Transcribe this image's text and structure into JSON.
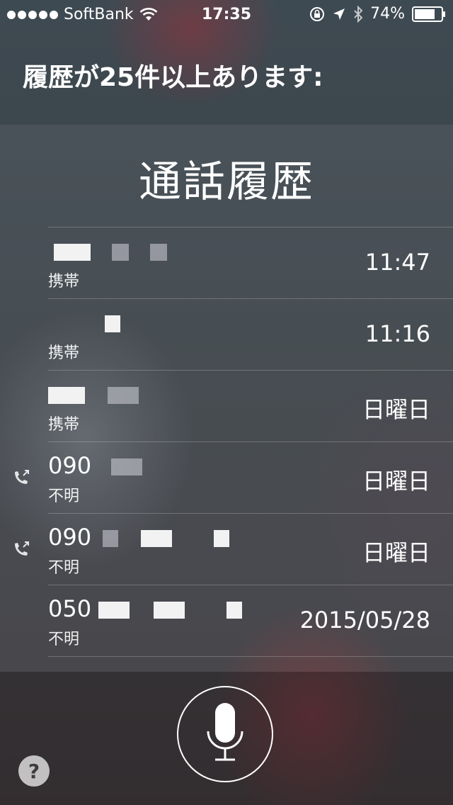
{
  "status_bar": {
    "carrier": "SoftBank",
    "time": "17:35",
    "battery": "74%",
    "icons": [
      "signal-dots-icon",
      "wifi-icon",
      "rotation-lock-icon",
      "location-arrow-icon",
      "bluetooth-icon",
      "battery-icon"
    ]
  },
  "siri": {
    "heading": "履歴が25件以上あります:"
  },
  "card": {
    "title": "通話履歴",
    "rows": [
      {
        "name": "",
        "type": "携帯",
        "when": "11:47",
        "outgoing": false
      },
      {
        "name": "",
        "type": "携帯",
        "when": "11:16",
        "outgoing": false
      },
      {
        "name": "",
        "type": "携帯",
        "when": "日曜日",
        "outgoing": false
      },
      {
        "name": "090",
        "type": "不明",
        "when": "日曜日",
        "outgoing": true
      },
      {
        "name": "090",
        "type": "不明",
        "when": "日曜日",
        "outgoing": true
      },
      {
        "name": "050",
        "type": "不明",
        "when": "2015/05/28",
        "outgoing": false
      }
    ]
  },
  "bottom": {
    "help_label": "?"
  }
}
